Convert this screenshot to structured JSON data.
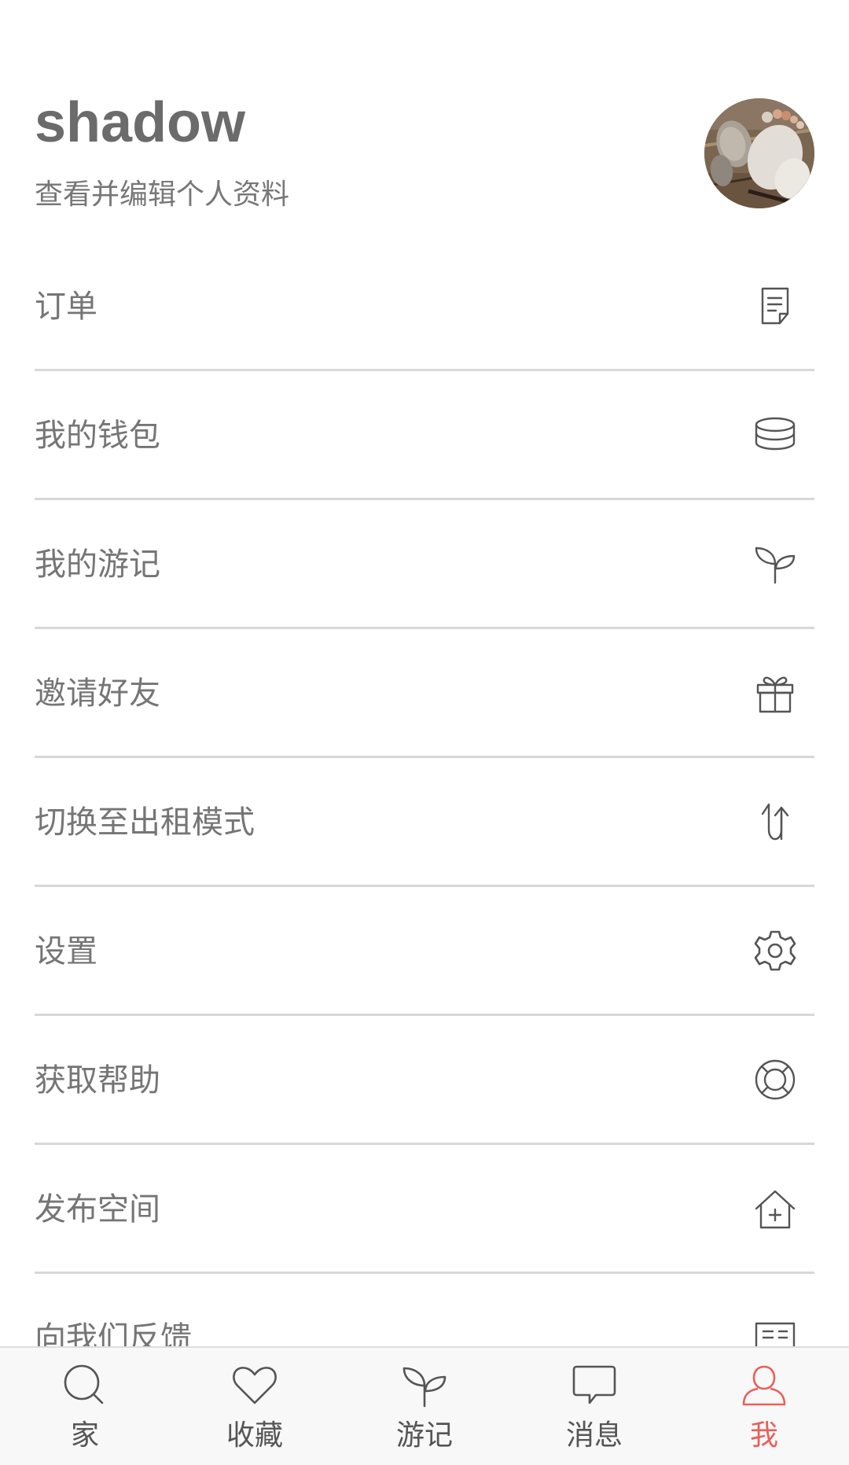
{
  "profile": {
    "username": "shadow",
    "subtitle": "查看并编辑个人资料"
  },
  "menu": {
    "items": [
      {
        "label": "订单",
        "icon": "order-document-icon"
      },
      {
        "label": "我的钱包",
        "icon": "wallet-coins-icon"
      },
      {
        "label": "我的游记",
        "icon": "sprout-icon"
      },
      {
        "label": "邀请好友",
        "icon": "gift-icon"
      },
      {
        "label": "切换至出租模式",
        "icon": "switch-arrows-icon"
      },
      {
        "label": "设置",
        "icon": "gear-icon"
      },
      {
        "label": "获取帮助",
        "icon": "lifebuoy-icon"
      },
      {
        "label": "发布空间",
        "icon": "house-plus-icon"
      },
      {
        "label": "向我们反馈",
        "icon": "feedback-icon"
      }
    ]
  },
  "tabbar": {
    "tabs": [
      {
        "label": "家",
        "icon": "search-icon",
        "active": false
      },
      {
        "label": "收藏",
        "icon": "heart-icon",
        "active": false
      },
      {
        "label": "游记",
        "icon": "sprout-icon",
        "active": false
      },
      {
        "label": "消息",
        "icon": "chat-bubble-icon",
        "active": false
      },
      {
        "label": "我",
        "icon": "person-icon",
        "active": true
      }
    ]
  },
  "colors": {
    "accent": "#e8605a",
    "text": "#757575",
    "divider": "#d8d8d8",
    "tabbar_bg": "#f8f8f8"
  }
}
